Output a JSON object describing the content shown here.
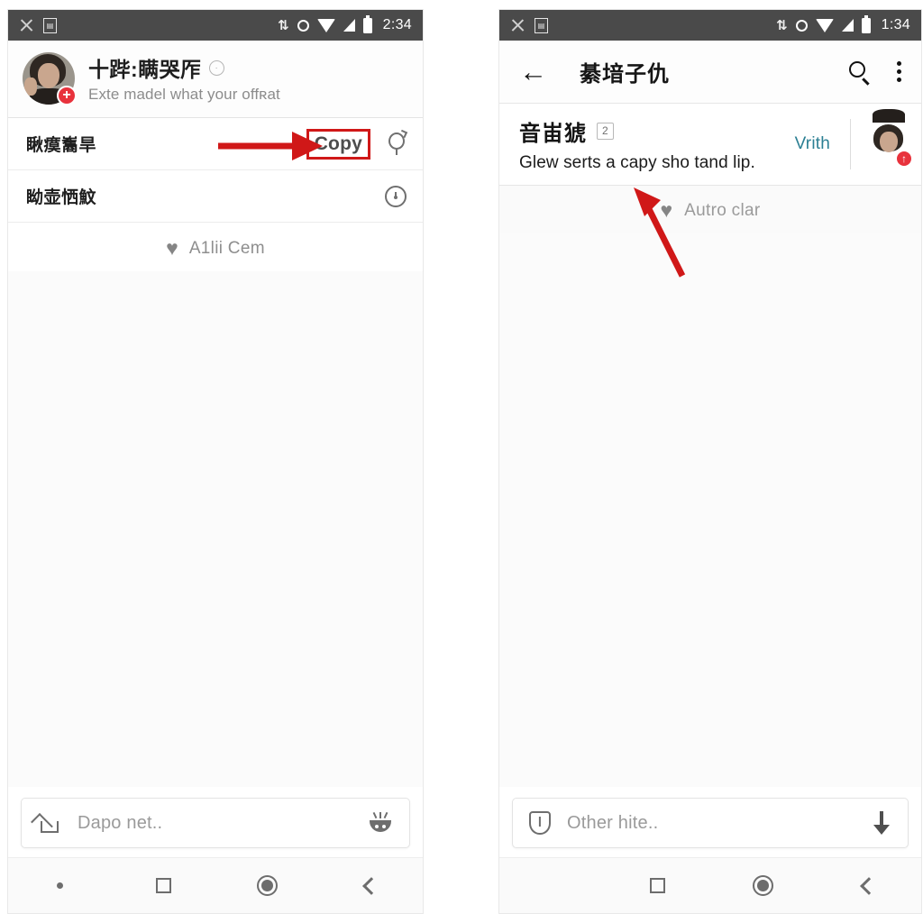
{
  "left_phone": {
    "status_bar": {
      "icons": [
        "no-sim-icon",
        "sd-card-icon",
        "sync-icon",
        "ring-icon",
        "wifi-icon",
        "signal-icon",
        "battery-icon"
      ],
      "time": "2:34"
    },
    "app_bar": {
      "avatar": "user-avatar",
      "badge": "+",
      "title": "十跸:瞒哭厏",
      "title_badge": "info-icon",
      "subtitle": "Exte madel ᴡhat your offʀat"
    },
    "rows": [
      {
        "label": "瞅瘼雟旱",
        "action_label": "Copy",
        "trailing_icon": "balloon-icon",
        "highlighted": true
      },
      {
        "label": "眑壶恓魰",
        "action_label": "",
        "trailing_icon": "clock-icon",
        "highlighted": false
      }
    ],
    "heart_line": {
      "icon": "heart-icon",
      "label": "A1lii Cem"
    },
    "input_bar": {
      "leading_icon": "home-icon",
      "placeholder": "Dapo net..",
      "trailing_icon": "bowl-face-icon"
    },
    "nav_bar": [
      "dot-indicator",
      "recents-square-icon",
      "home-circle-icon",
      "back-chevron-icon"
    ]
  },
  "right_phone": {
    "status_bar": {
      "icons": [
        "no-sim-icon",
        "sd-card-icon",
        "sync-icon",
        "ring-icon",
        "wifi-icon",
        "signal-icon",
        "battery-icon"
      ],
      "time": "1:34"
    },
    "app_bar": {
      "back_icon": "back-arrow-icon",
      "title": "綦堷子仇",
      "search_icon": "search-icon",
      "overflow_icon": "kebab-menu-icon"
    },
    "card": {
      "title": "音峀猇",
      "count_chip": "2",
      "subtitle": "Glew serts a capy sho tand lip.",
      "side_link": "Vrith",
      "avatar": "user-avatar",
      "badge": "↑"
    },
    "heart_line": {
      "icon": "heart-icon",
      "label": "Autro clar"
    },
    "input_bar": {
      "leading_icon": "shield-icon",
      "placeholder": "Other hite..",
      "trailing_icon": "download-arrow-icon"
    },
    "nav_bar": [
      "recents-square-icon",
      "home-circle-icon",
      "back-chevron-icon"
    ]
  },
  "annotations": [
    {
      "name": "arrow-to-copy-button",
      "color": "#d01818",
      "style": "horizontal-arrow-right"
    },
    {
      "name": "arrow-to-heart-icon",
      "color": "#d01818",
      "style": "diagonal-arrow-up-left"
    }
  ],
  "colors": {
    "status_bar_bg": "#4a4a4a",
    "accent_red": "#d01818",
    "badge_red": "#e8323c",
    "link_teal": "#2b7f93",
    "muted_text": "#8e8e8e"
  }
}
